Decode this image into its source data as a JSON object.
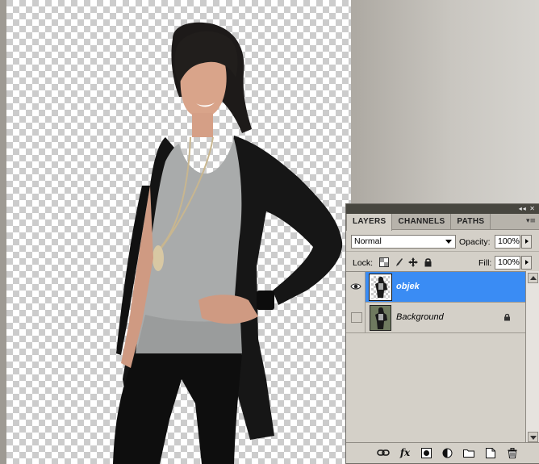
{
  "layers_panel": {
    "tabs": [
      {
        "label": "LAYERS"
      },
      {
        "label": "CHANNELS"
      },
      {
        "label": "PATHS"
      }
    ],
    "titlebar_icons": "◂◂ ✕",
    "menu_icon": "▾≡",
    "blend_mode": "Normal",
    "opacity_label": "Opacity:",
    "opacity_value": "100%",
    "lock_label": "Lock:",
    "fill_label": "Fill:",
    "fill_value": "100%",
    "layers": [
      {
        "name": "objek",
        "visible": true,
        "selected": true,
        "locked": false
      },
      {
        "name": "Background",
        "visible": false,
        "selected": false,
        "locked": true
      }
    ],
    "toolbar_icons": [
      "link-layers-icon",
      "fx-icon",
      "layer-mask-icon",
      "adjustment-layer-icon",
      "new-group-icon",
      "new-layer-icon",
      "trash-icon"
    ],
    "fx_label": "fx"
  },
  "colors": {
    "selection": "#3a8cf4",
    "panel_bg": "#d4d0c8",
    "titlebar": "#47463f"
  }
}
